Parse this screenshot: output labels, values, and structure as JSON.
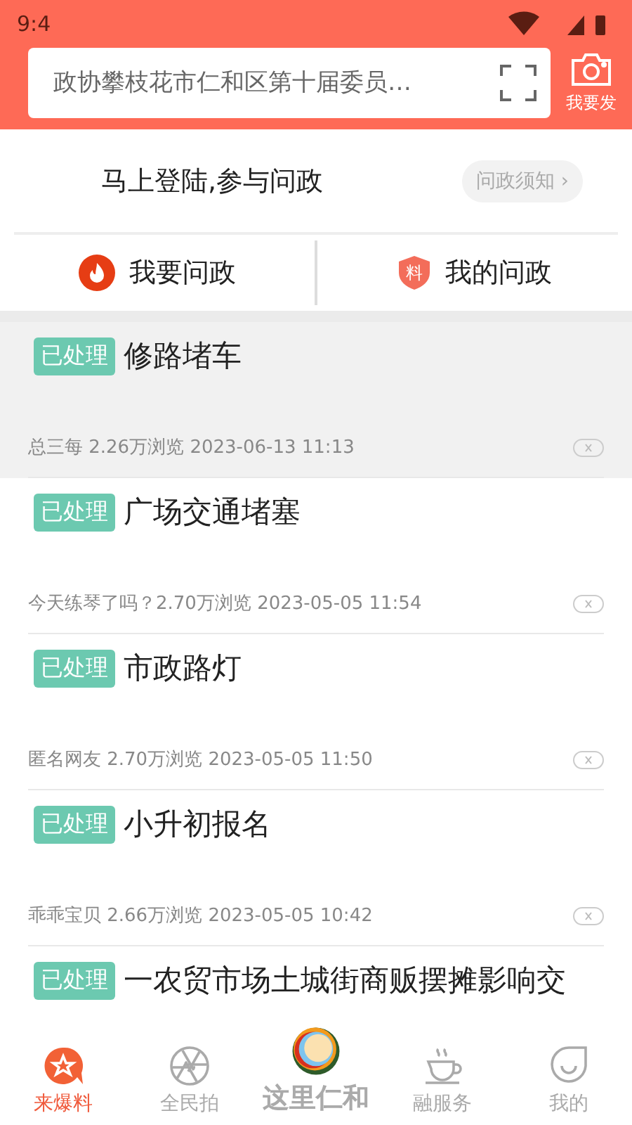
{
  "status_bar": {
    "time": "9:4"
  },
  "search": {
    "placeholder": "政协攀枝花市仁和区第十届委员…"
  },
  "camera_button": {
    "label": "我要发"
  },
  "login": {
    "prompt": "马上登陆,参与问政",
    "notice_button": "问政须知 ›"
  },
  "actions": [
    {
      "kind": "fire",
      "label": "我要问政"
    },
    {
      "kind": "shield",
      "label": "我的问政",
      "badge": "料"
    }
  ],
  "posts": [
    {
      "status": "已处理",
      "title": "修路堵车",
      "meta": "总三每 2.26万浏览 2023-06-13 11:13",
      "selected": true
    },
    {
      "status": "已处理",
      "title": "广场交通堵塞",
      "meta": "今天练琴了吗？2.70万浏览 2023-05-05 11:54",
      "selected": false
    },
    {
      "status": "已处理",
      "title": "市政路灯",
      "meta": "匿名网友 2.70万浏览 2023-05-05 11:50",
      "selected": false
    },
    {
      "status": "已处理",
      "title": "小升初报名",
      "meta": "乖乖宝贝 2.66万浏览 2023-05-05 10:42",
      "selected": false
    },
    {
      "status": "已处理",
      "title": "一农贸市场土城街商贩摆摊影响交",
      "selected": false
    }
  ],
  "tab_bar": [
    {
      "kind": "star",
      "label": "来爆料",
      "selected": true
    },
    {
      "kind": "aperture",
      "label": "全民拍",
      "selected": false
    },
    {
      "kind": "logo",
      "label": "这里仁和",
      "selected": false
    },
    {
      "kind": "cup",
      "label": "融服务",
      "selected": false
    },
    {
      "kind": "face",
      "label": "我的",
      "selected": false
    }
  ]
}
